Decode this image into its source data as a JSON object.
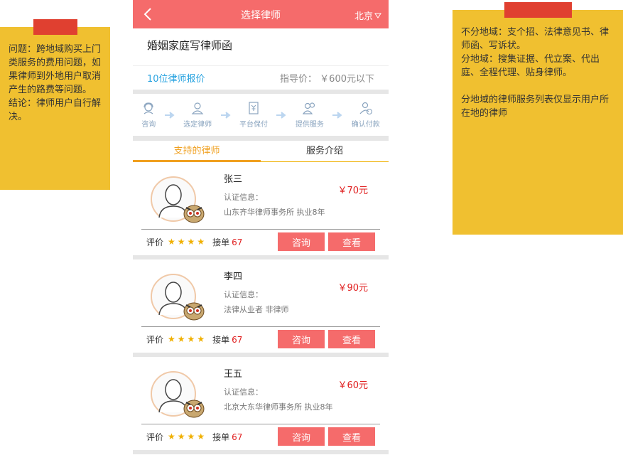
{
  "notes": {
    "left": "问题：跨地域购买上门类服务的费用问题，如果律师到外地用户取消产生的路费等问题。\n结论：律师用户自行解决。",
    "right": "不分地域：支个招、法律意见书、律师函、写诉状。\n分地域：搜集证据、代立案、代出庭、全程代理、贴身律师。\n\n分地域的律师服务列表仅显示用户所在地的律师"
  },
  "header": {
    "title": "选择律师",
    "city": "北京"
  },
  "service": {
    "title": "婚姻家庭写律师函",
    "quote_count": "10位律师报价",
    "guide_price": "指导价：  ￥600元以下"
  },
  "steps": [
    {
      "label": "咨询",
      "icon": "headset-icon"
    },
    {
      "label": "选定律师",
      "icon": "person-icon"
    },
    {
      "label": "平台保付",
      "icon": "yen-doc-icon"
    },
    {
      "label": "提供服务",
      "icon": "people-icon"
    },
    {
      "label": "确认付款",
      "icon": "person-pay-icon"
    }
  ],
  "tabs": {
    "supported": "支持的律师",
    "intro": "服务介绍"
  },
  "lawyers": [
    {
      "name": "张三",
      "verify": "认证信息：",
      "info": "山东齐华律师事务所     执业8年",
      "price": "￥70元",
      "rating_label": "评价",
      "stars": 4,
      "orders_label": "接单",
      "orders": "67",
      "consult": "咨询",
      "view": "查看"
    },
    {
      "name": "李四",
      "verify": "认证信息：",
      "info": "法律从业者  非律师",
      "price": "￥90元",
      "rating_label": "评价",
      "stars": 4,
      "orders_label": "接单",
      "orders": "67",
      "consult": "咨询",
      "view": "查看"
    },
    {
      "name": "王五",
      "verify": "认证信息：",
      "info": "北京大东华律师事务所  执业8年",
      "price": "￥60元",
      "rating_label": "评价",
      "stars": 4,
      "orders_label": "接单",
      "orders": "67",
      "consult": "咨询",
      "view": "查看"
    }
  ],
  "colors": {
    "header": "#f56b6b",
    "accent": "#f0a020",
    "price": "#e02020",
    "link": "#29a3e0",
    "note": "#f0c030",
    "pin": "#e04030"
  }
}
